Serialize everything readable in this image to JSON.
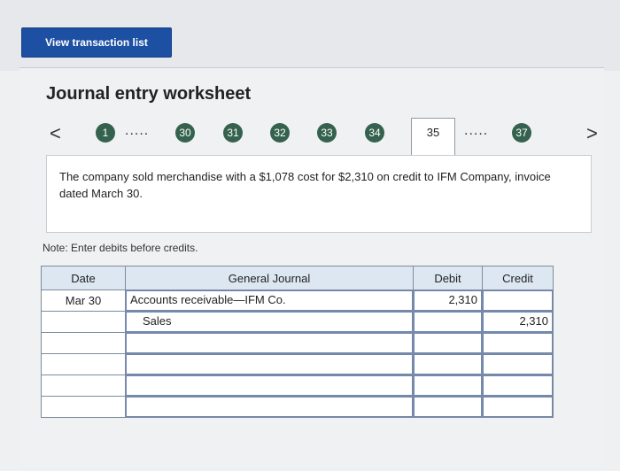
{
  "header": {
    "view_button_label": "View transaction list"
  },
  "worksheet": {
    "title": "Journal entry worksheet",
    "steps": {
      "first": "1",
      "s30": "30",
      "s31": "31",
      "s32": "32",
      "s33": "33",
      "s34": "34",
      "current": "35",
      "last": "37",
      "ellipsis": "....."
    },
    "prev_arrow": "<",
    "next_arrow": ">",
    "description": "The company sold merchandise with a $1,078 cost for $2,310 on credit to IFM Company, invoice dated March 30.",
    "note": "Note: Enter debits before credits."
  },
  "journal": {
    "headers": {
      "date": "Date",
      "general_journal": "General Journal",
      "debit": "Debit",
      "credit": "Credit"
    },
    "rows": [
      {
        "date": "Mar 30",
        "account": "Accounts receivable—IFM Co.",
        "debit": "2,310",
        "credit": ""
      },
      {
        "date": "",
        "account": "Sales",
        "debit": "",
        "credit": "2,310"
      },
      {
        "date": "",
        "account": "",
        "debit": "",
        "credit": ""
      },
      {
        "date": "",
        "account": "",
        "debit": "",
        "credit": ""
      },
      {
        "date": "",
        "account": "",
        "debit": "",
        "credit": ""
      },
      {
        "date": "",
        "account": "",
        "debit": "",
        "credit": ""
      }
    ]
  },
  "colors": {
    "primary_button": "#1d4fa3",
    "step_circle": "#35624f",
    "table_header": "#dde7f2"
  }
}
